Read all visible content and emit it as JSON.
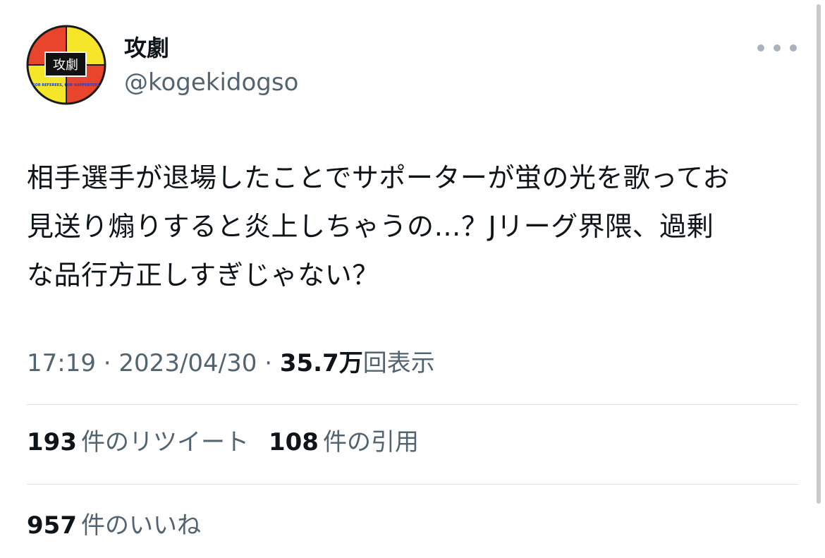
{
  "author": {
    "display_name": "攻劇",
    "handle": "@kogekidogso",
    "avatar": {
      "label": "攻劇",
      "ring_text": "FOR REFEREES, FOR SUPPORTERS",
      "colors": {
        "red": "#e8452c",
        "yellow": "#f6e62a",
        "border": "#1a1a1a",
        "badge_bg": "#111111",
        "badge_text": "#ffffff",
        "ring_text": "#1a3fd6"
      }
    }
  },
  "more_icon": "more-horizontal-icon",
  "tweet": {
    "lines": [
      "相手選手が退場したことでサポーターが蛍の光を歌ってお",
      "見送り煽りすると炎上しちゃうの…？Jリーグ界隈、過剰",
      "な品行方正しすぎじゃない？"
    ]
  },
  "meta": {
    "time": "17:19",
    "sep1": " · ",
    "date": "2023/04/30",
    "sep2": " · ",
    "views_count": "35.7万",
    "views_label": "回表示"
  },
  "stats": {
    "retweets": {
      "count": "193",
      "label": "件のリツイート"
    },
    "quotes": {
      "count": "108",
      "label": "件の引用"
    },
    "likes": {
      "count": "957",
      "label": "件のいいね"
    }
  },
  "colors": {
    "text": "#0f1419",
    "secondary": "#536471",
    "divider": "#dfe3e6"
  }
}
